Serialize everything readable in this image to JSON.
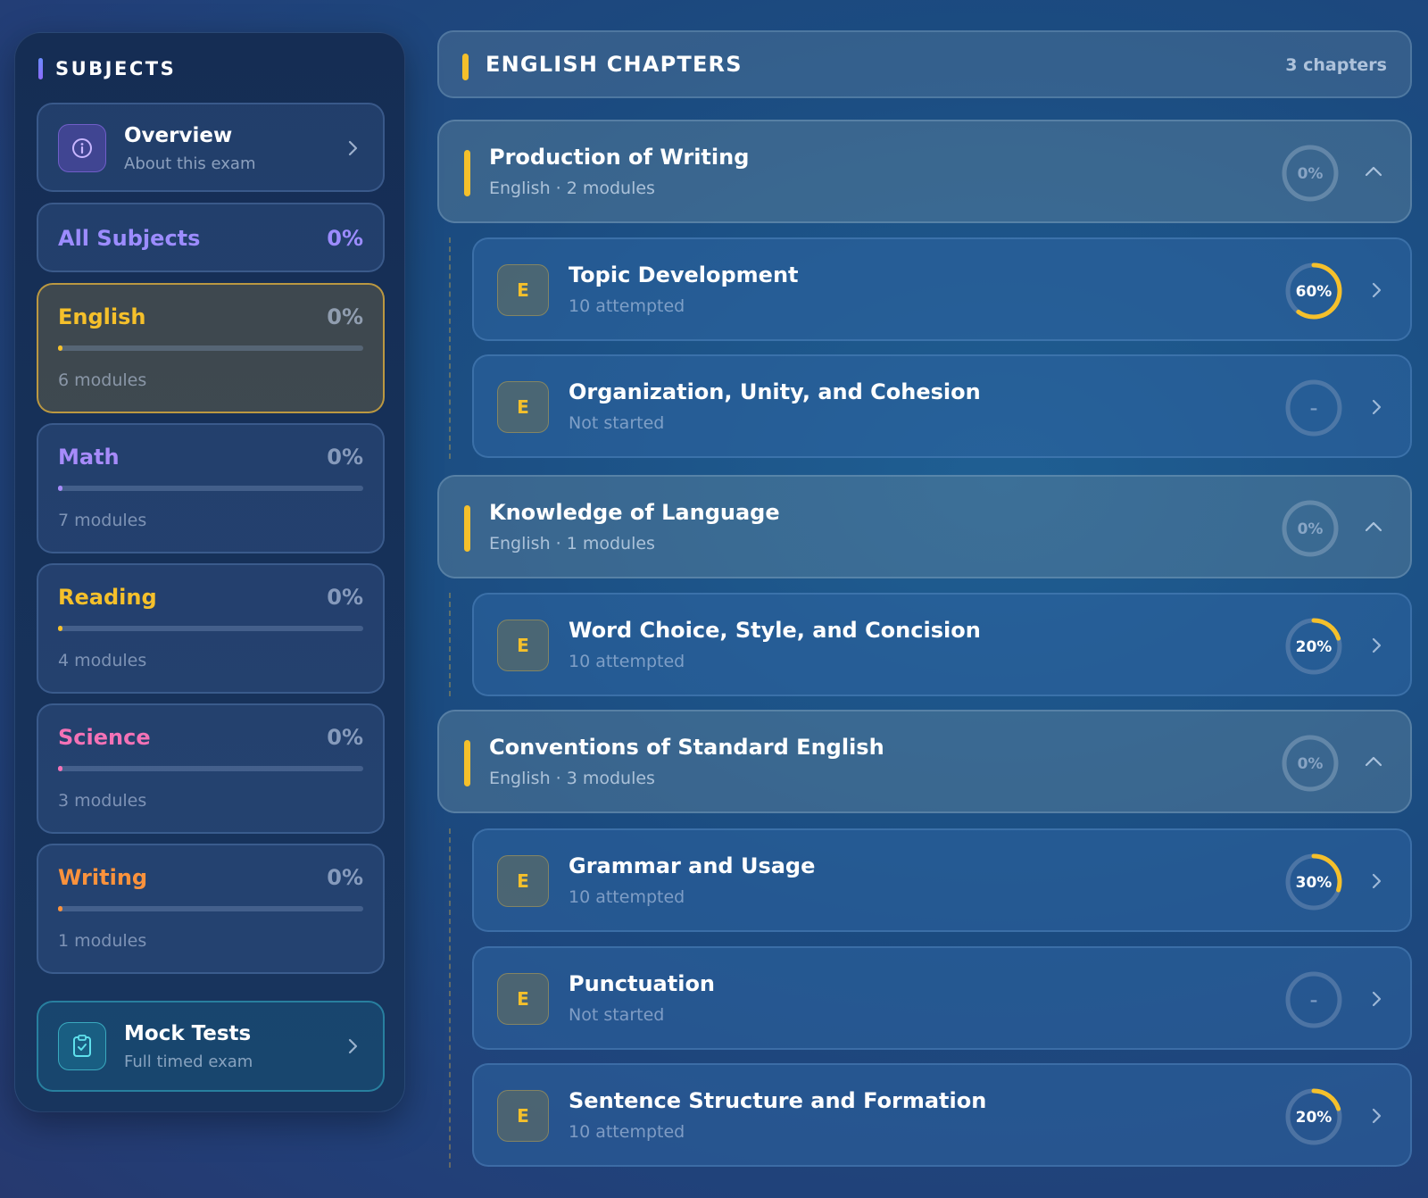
{
  "sidebar": {
    "title": "SUBJECTS",
    "overview": {
      "title": "Overview",
      "subtitle": "About this exam",
      "icon": "info-icon"
    },
    "all_subjects": {
      "label": "All Subjects",
      "percent": "0%"
    },
    "subjects": [
      {
        "name": "English",
        "percent": "0%",
        "modules": "6 modules",
        "progress": 0,
        "color": "#f5c02b",
        "active": true
      },
      {
        "name": "Math",
        "percent": "0%",
        "modules": "7 modules",
        "progress": 0,
        "color": "#a78bfa",
        "active": false
      },
      {
        "name": "Reading",
        "percent": "0%",
        "modules": "4 modules",
        "progress": 0,
        "color": "#f5c02b",
        "active": false
      },
      {
        "name": "Science",
        "percent": "0%",
        "modules": "3 modules",
        "progress": 0,
        "color": "#f472b6",
        "active": false
      },
      {
        "name": "Writing",
        "percent": "0%",
        "modules": "1 modules",
        "progress": 0,
        "color": "#fb923c",
        "active": false
      }
    ],
    "mock_tests": {
      "title": "Mock Tests",
      "subtitle": "Full timed exam",
      "icon": "clipboard-check-icon"
    }
  },
  "main": {
    "header": {
      "title": "ENGLISH CHAPTERS",
      "count": "3 chapters"
    },
    "chapters": [
      {
        "name": "Production of Writing",
        "subtitle": "English · 2 modules",
        "percent": "0%",
        "modules": [
          {
            "badge": "E",
            "name": "Topic Development",
            "status": "10 attempted",
            "percent": "60%",
            "progress": 0.6
          },
          {
            "badge": "E",
            "name": "Organization, Unity, and Cohesion",
            "status": "Not started",
            "percent": "–",
            "progress": 0
          }
        ]
      },
      {
        "name": "Knowledge of Language",
        "subtitle": "English · 1 modules",
        "percent": "0%",
        "modules": [
          {
            "badge": "E",
            "name": "Word Choice, Style, and Concision",
            "status": "10 attempted",
            "percent": "20%",
            "progress": 0.2
          }
        ]
      },
      {
        "name": "Conventions of Standard English",
        "subtitle": "English · 3 modules",
        "percent": "0%",
        "modules": [
          {
            "badge": "E",
            "name": "Grammar and Usage",
            "status": "10 attempted",
            "percent": "30%",
            "progress": 0.3
          },
          {
            "badge": "E",
            "name": "Punctuation",
            "status": "Not started",
            "percent": "–",
            "progress": 0
          },
          {
            "badge": "E",
            "name": "Sentence Structure and Formation",
            "status": "10 attempted",
            "percent": "20%",
            "progress": 0.2
          }
        ]
      }
    ]
  },
  "colors": {
    "accent": "#f5c02b",
    "purple": "#9c8cff",
    "teal": "#4fd1e0"
  }
}
